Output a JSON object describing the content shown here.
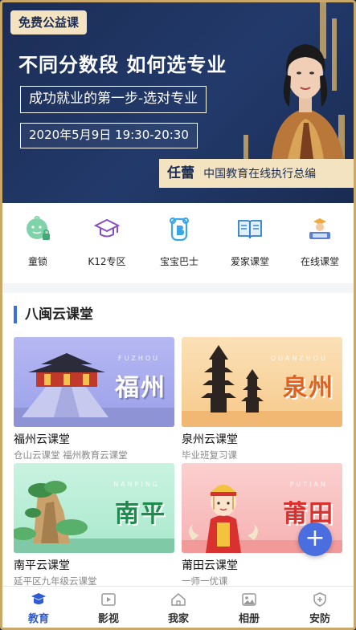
{
  "banner": {
    "badge": "免费公益课",
    "title": "不同分数段 如何选专业",
    "subtitle": "成功就业的第一步-选对专业",
    "date": "2020年5月9日 19:30-20:30",
    "speaker_name": "任蕾",
    "speaker_title": "中国教育在线执行总编"
  },
  "quick_items": [
    {
      "label": "童锁",
      "icon": "child-lock-icon"
    },
    {
      "label": "K12专区",
      "icon": "graduation-cap-icon"
    },
    {
      "label": "宝宝巴士",
      "icon": "baby-bus-icon"
    },
    {
      "label": "爱家课堂",
      "icon": "open-book-icon"
    },
    {
      "label": "在线课堂",
      "icon": "online-class-icon"
    }
  ],
  "section": {
    "title": "八闽云课堂",
    "cards": [
      {
        "title": "福州云课堂",
        "subtitle": "仓山云课堂 福州教育云课堂",
        "city": "福州",
        "pinyin": "FUZHOU"
      },
      {
        "title": "泉州云课堂",
        "subtitle": "毕业班复习课",
        "city": "泉州",
        "pinyin": "QUANZHOU"
      },
      {
        "title": "南平云课堂",
        "subtitle": "延平区九年级云课堂",
        "city": "南平",
        "pinyin": "NANPING"
      },
      {
        "title": "莆田云课堂",
        "subtitle": "一师一优课",
        "city": "莆田",
        "pinyin": "PUTIAN"
      }
    ]
  },
  "fab": {
    "label": "+"
  },
  "tabs": [
    {
      "label": "教育",
      "icon": "education-icon"
    },
    {
      "label": "影视",
      "icon": "video-icon"
    },
    {
      "label": "我家",
      "icon": "home-icon"
    },
    {
      "label": "相册",
      "icon": "album-icon"
    },
    {
      "label": "安防",
      "icon": "shield-icon"
    }
  ],
  "colors": {
    "accent": "#2d5bd6",
    "gold": "#c9a86a",
    "navy": "#1c2d55"
  }
}
